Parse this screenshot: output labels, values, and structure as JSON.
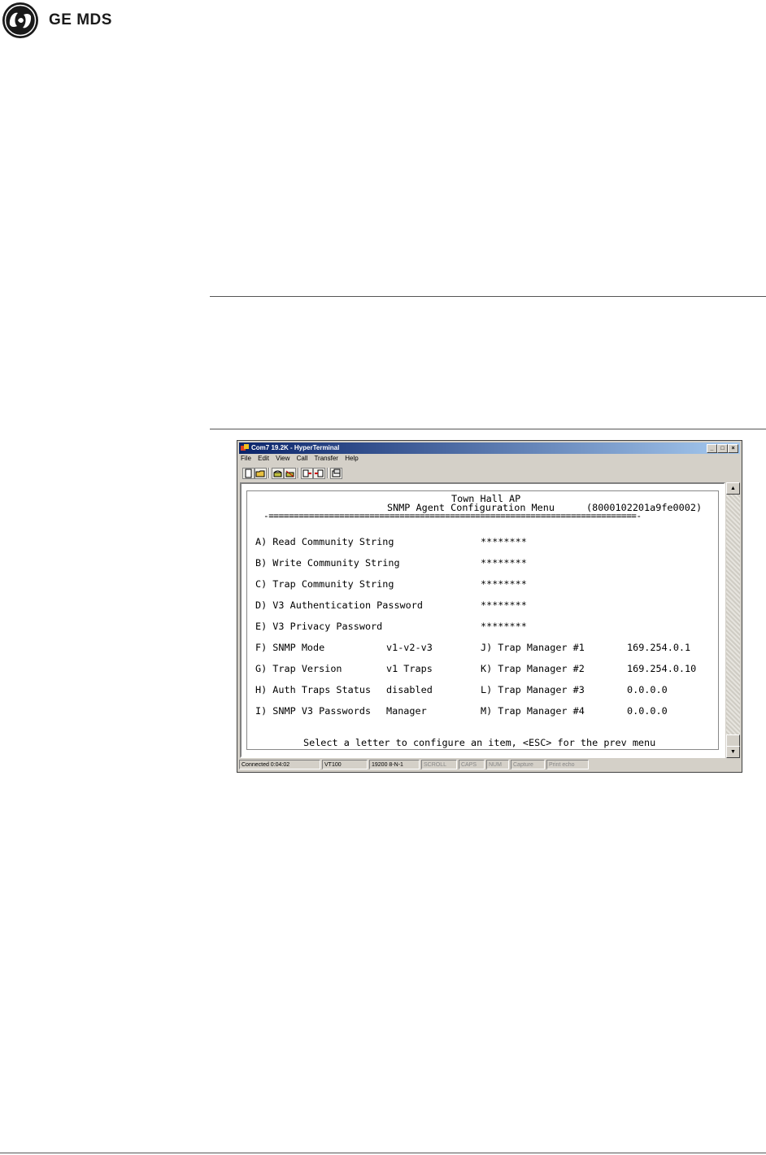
{
  "brand": {
    "name": "GE MDS"
  },
  "window": {
    "title": "Com7 19.2K - HyperTerminal",
    "controls": [
      "_",
      "□",
      "×"
    ],
    "menus": [
      "File",
      "Edit",
      "View",
      "Call",
      "Transfer",
      "Help"
    ]
  },
  "terminal": {
    "header_name": "Town Hall AP",
    "header_title": "SNMP Agent Configuration Menu",
    "header_id": "(8000102201a9fe0002)",
    "separator": "-=========================================================================-",
    "items": [
      {
        "label": "A) Read Community String",
        "value": "********"
      },
      {
        "label": "B) Write Community String",
        "value": "********"
      },
      {
        "label": "C) Trap Community String",
        "value": "********"
      },
      {
        "label": "D) V3 Authentication Password",
        "value": "********"
      },
      {
        "label": "E) V3 Privacy Password",
        "value": "********"
      }
    ],
    "pairs": [
      {
        "left_label": "F) SNMP Mode",
        "left_value": "v1-v2-v3",
        "right_label": "J) Trap Manager #1",
        "right_value": "169.254.0.1"
      },
      {
        "left_label": "G) Trap Version",
        "left_value": "v1 Traps",
        "right_label": "K) Trap Manager #2",
        "right_value": "169.254.0.10"
      },
      {
        "left_label": "H) Auth Traps Status",
        "left_value": "disabled",
        "right_label": "L) Trap Manager #3",
        "right_value": "0.0.0.0"
      },
      {
        "left_label": "I) SNMP V3 Passwords",
        "left_value": "Manager",
        "right_label": "M) Trap Manager #4",
        "right_value": "0.0.0.0"
      }
    ],
    "prompt": "Select a letter to configure an item, <ESC> for the prev menu"
  },
  "statusbar": {
    "connected": "Connected 0:04:02",
    "emulation": "VT100",
    "port": "19200 8-N-1",
    "scroll": "SCROLL",
    "caps": "CAPS",
    "num": "NUM",
    "capture": "Capture",
    "print": "Print echo"
  }
}
